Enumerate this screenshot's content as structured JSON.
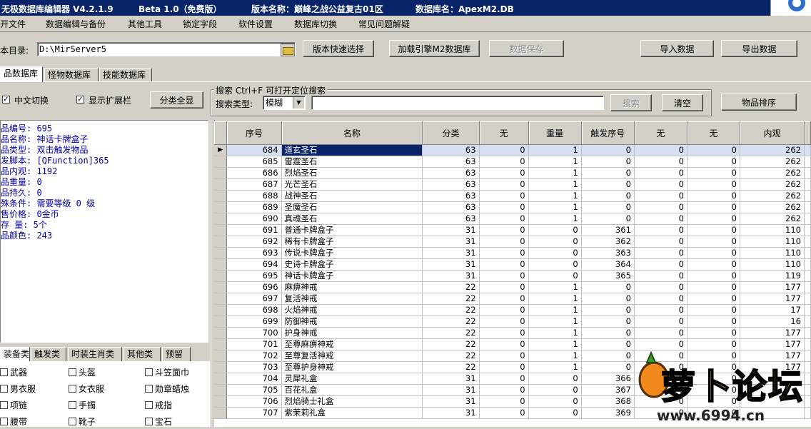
{
  "titlebar": {
    "app": "无极数据库编辑器 V4.2.1.9",
    "edition": "Beta 1.0（免费版）",
    "version_label": "版本名称：巅峰之战公益复古01区",
    "db_label": "数据库名：ApexM2.DB"
  },
  "menu": [
    "开文件",
    "数据编辑与备份",
    "其他工具",
    "锁定字段",
    "软件设置",
    "数据库切换",
    "常见问题解疑"
  ],
  "toolbar": {
    "dir_label": "本目录:",
    "dir_value": "D:\\MirServer5",
    "version_select": "版本快速选择",
    "load_engine": "加载引擎M2数据库",
    "save_data": "数据保存",
    "import": "导入数据",
    "export": "导出数据"
  },
  "tabs": [
    "品数据库",
    "怪物数据库",
    "技能数据库"
  ],
  "options": {
    "chinese_toggle": "中文切换",
    "show_ext": "显示扩展栏",
    "category_all": "分类全显"
  },
  "search": {
    "group_label": "搜索   Ctrl+F 可打开定位搜索",
    "type_label": "搜索类型:",
    "type_value": "模糊",
    "query": "",
    "search_btn": "搜索",
    "clear_btn": "清空",
    "sort_btn": "物品排序"
  },
  "info": [
    "品编号: 695",
    "品名称: 神话卡牌盒子",
    "品类型: 双击触发物品",
    "发脚本: [QFunction]365",
    "品内观: 1192",
    "品重量: 0",
    "品持久: 0",
    "殊条件: 需要等级 0 级",
    "售价格: 0金币",
    " 存 量: 5个",
    "品颜色: 243"
  ],
  "bottom_tabs": [
    "装备类",
    "触发类",
    "时装生肖类",
    "其他类",
    "预留"
  ],
  "categories": [
    [
      "武器",
      "头盔",
      "斗笠面巾"
    ],
    [
      "男衣服",
      "女衣服",
      "勋章蜡烛"
    ],
    [
      "项链",
      "手镯",
      "戒指"
    ],
    [
      "腰带",
      "靴子",
      "宝石"
    ]
  ],
  "grid": {
    "columns": [
      "序号",
      "名称",
      "分类",
      "无",
      "重量",
      "触发序号",
      "无",
      "无",
      "内观"
    ],
    "rows": [
      [
        "684",
        "道玄圣石",
        "63",
        "0",
        "1",
        "0",
        "0",
        "0",
        "262"
      ],
      [
        "685",
        "雷霆圣石",
        "63",
        "0",
        "1",
        "0",
        "0",
        "0",
        "262"
      ],
      [
        "686",
        "烈焰圣石",
        "63",
        "0",
        "1",
        "0",
        "0",
        "0",
        "262"
      ],
      [
        "687",
        "光芒圣石",
        "63",
        "0",
        "1",
        "0",
        "0",
        "0",
        "262"
      ],
      [
        "688",
        "战神圣石",
        "63",
        "0",
        "1",
        "0",
        "0",
        "0",
        "262"
      ],
      [
        "689",
        "圣魔圣石",
        "63",
        "0",
        "1",
        "0",
        "0",
        "0",
        "262"
      ],
      [
        "690",
        "真魂圣石",
        "63",
        "0",
        "1",
        "0",
        "0",
        "0",
        "262"
      ],
      [
        "691",
        "普通卡牌盒子",
        "31",
        "0",
        "0",
        "361",
        "0",
        "0",
        "110"
      ],
      [
        "692",
        "稀有卡牌盒子",
        "31",
        "0",
        "0",
        "362",
        "0",
        "0",
        "110"
      ],
      [
        "693",
        "传说卡牌盒子",
        "31",
        "0",
        "0",
        "363",
        "0",
        "0",
        "110"
      ],
      [
        "694",
        "史诗卡牌盒子",
        "31",
        "0",
        "0",
        "364",
        "0",
        "0",
        "110"
      ],
      [
        "695",
        "神话卡牌盒子",
        "31",
        "0",
        "0",
        "365",
        "0",
        "0",
        "119"
      ],
      [
        "696",
        "麻痹神戒",
        "22",
        "0",
        "1",
        "0",
        "0",
        "0",
        "177"
      ],
      [
        "697",
        "复活神戒",
        "22",
        "0",
        "1",
        "0",
        "0",
        "0",
        "177"
      ],
      [
        "698",
        "火焰神戒",
        "22",
        "0",
        "1",
        "0",
        "0",
        "0",
        "17"
      ],
      [
        "699",
        "防御神戒",
        "22",
        "0",
        "1",
        "0",
        "0",
        "0",
        "16"
      ],
      [
        "700",
        "护身神戒",
        "22",
        "0",
        "1",
        "0",
        "0",
        "0",
        "177"
      ],
      [
        "701",
        "至尊麻痹神戒",
        "22",
        "0",
        "1",
        "0",
        "0",
        "0",
        "177"
      ],
      [
        "702",
        "至尊复活神戒",
        "22",
        "0",
        "1",
        "0",
        "0",
        "0",
        "177"
      ],
      [
        "703",
        "至尊护身神戒",
        "22",
        "0",
        "1",
        "0",
        "0",
        "0",
        "177"
      ],
      [
        "704",
        "灵犀礼盒",
        "31",
        "0",
        "0",
        "366",
        "0",
        "0",
        ""
      ],
      [
        "705",
        "百花礼盒",
        "31",
        "0",
        "0",
        "367",
        "0",
        "0",
        ""
      ],
      [
        "706",
        "烈焰骑士礼盒",
        "31",
        "0",
        "0",
        "368",
        "0",
        "0",
        ""
      ],
      [
        "707",
        "紫茉莉礼盒",
        "31",
        "0",
        "0",
        "369",
        "0",
        "0",
        ""
      ]
    ]
  },
  "watermark": {
    "text": "萝卜论坛",
    "url": "www.6994.cn"
  },
  "colors": {
    "titlebar": "#0a246a",
    "selection": "#0a246a",
    "info_text": "#0000a8"
  }
}
